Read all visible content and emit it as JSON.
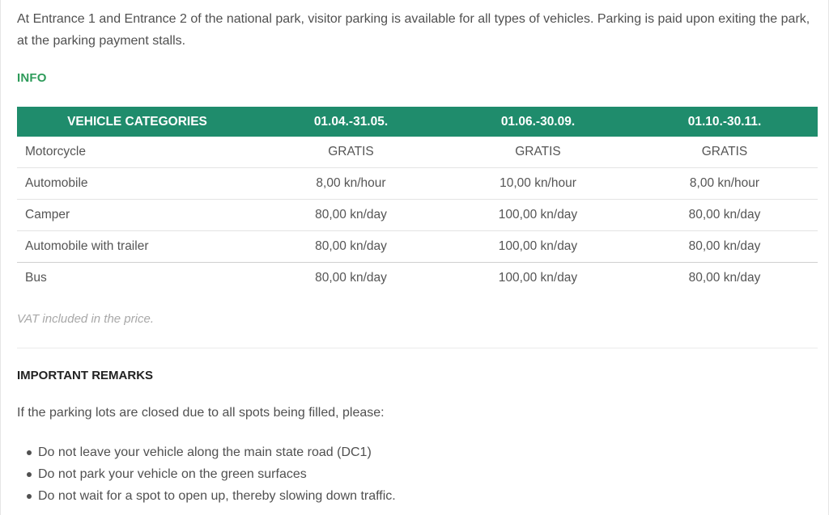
{
  "intro_text": "At Entrance 1 and Entrance 2 of the national park, visitor parking is available for all types of vehicles. Parking is paid upon exiting the park, at the parking payment stalls.",
  "info_heading": "INFO",
  "table": {
    "headers": [
      "VEHICLE CATEGORIES",
      "01.04.-31.05.",
      "01.06.-30.09.",
      "01.10.-30.11."
    ],
    "rows": [
      [
        "Motorcycle",
        "GRATIS",
        "GRATIS",
        "GRATIS"
      ],
      [
        "Automobile",
        "8,00 kn/hour",
        "10,00 kn/hour",
        "8,00 kn/hour"
      ],
      [
        "Camper",
        "80,00 kn/day",
        "100,00 kn/day",
        "80,00 kn/day"
      ],
      [
        "Automobile with trailer",
        "80,00 kn/day",
        "100,00 kn/day",
        "80,00 kn/day"
      ],
      [
        "Bus",
        "80,00 kn/day",
        "100,00 kn/day",
        "80,00 kn/day"
      ]
    ]
  },
  "vat_note": "VAT included in the price.",
  "remarks": {
    "heading": "IMPORTANT REMARKS",
    "intro": "If the parking lots are closed due to all spots being filled, please:",
    "items": [
      "Do not leave your vehicle along the main state road (DC1)",
      "Do not park your vehicle on the green surfaces",
      "Do not wait for a spot to open up, thereby slowing down traffic."
    ]
  },
  "colors": {
    "header_bg": "#1f8c6c",
    "info_heading": "#2e9b5a"
  }
}
